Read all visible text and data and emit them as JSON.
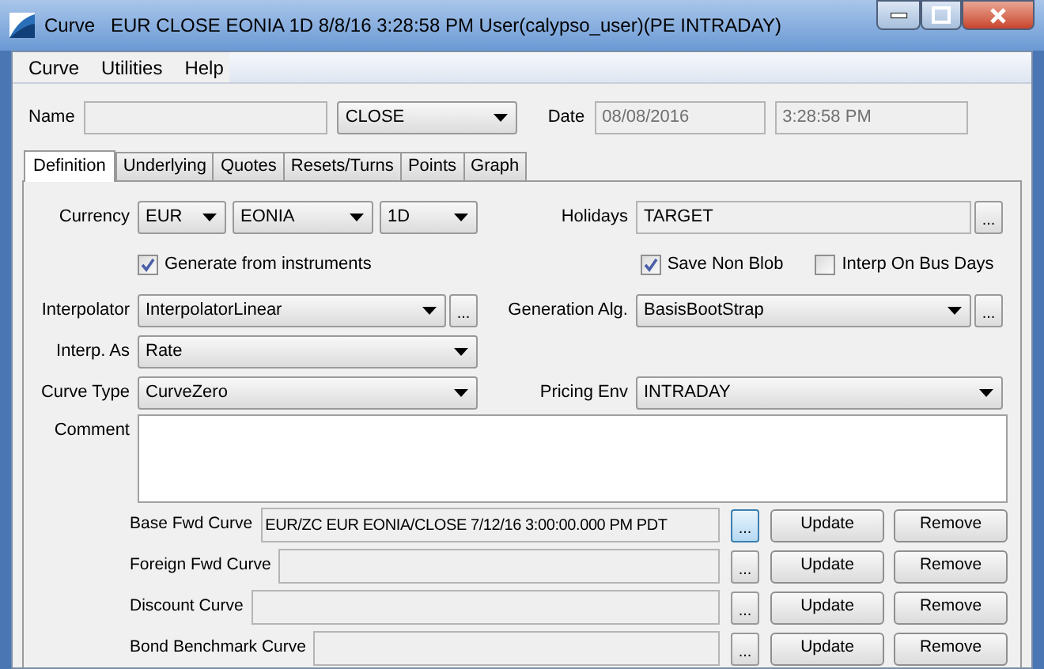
{
  "window": {
    "title": "Curve   EUR CLOSE EONIA 1D 8/8/16 3:28:58 PM User(calypso_user)(PE INTRADAY)"
  },
  "menu": [
    "Curve",
    "Utilities",
    "Help"
  ],
  "header": {
    "name_label": "Name",
    "name_type": "CLOSE",
    "date_label": "Date",
    "date": "08/08/2016",
    "time": "3:28:58 PM"
  },
  "tabs": [
    {
      "label": "Definition",
      "selected": true
    },
    {
      "label": "Underlying",
      "selected": false
    },
    {
      "label": "Quotes",
      "selected": false
    },
    {
      "label": "Resets/Turns",
      "selected": false
    },
    {
      "label": "Points",
      "selected": false
    },
    {
      "label": "Graph",
      "selected": false
    }
  ],
  "definition": {
    "currency": {
      "label": "Currency",
      "combos": [
        "EUR",
        "EONIA",
        "1D"
      ]
    },
    "holidays": {
      "label": "Holidays",
      "value": "TARGET",
      "browse": "..."
    },
    "generate_from_instruments": {
      "label": "Generate from instruments",
      "checked": true
    },
    "save_non_blob": {
      "label": "Save Non Blob",
      "checked": true
    },
    "interp_on_bus_days": {
      "label": "Interp On Bus Days",
      "checked": false
    },
    "interpolator": {
      "label": "Interpolator",
      "value": "InterpolatorLinear",
      "browse": "..."
    },
    "generation_alg": {
      "label": "Generation Alg.",
      "value": "BasisBootStrap",
      "browse": "..."
    },
    "interp_as": {
      "label": "Interp. As",
      "value": "Rate"
    },
    "curve_type": {
      "label": "Curve Type",
      "value": "CurveZero"
    },
    "pricing_env": {
      "label": "Pricing Env",
      "value": "INTRADAY"
    },
    "comment": {
      "label": "Comment"
    },
    "curves": [
      {
        "label": "Base Fwd Curve",
        "value": "EUR/ZC EUR EONIA/CLOSE 7/12/16 3:00:00.000 PM PDT",
        "browse": "...",
        "focused": true,
        "update": "Update",
        "remove": "Remove"
      },
      {
        "label": "Foreign Fwd Curve",
        "browse": "...",
        "focused": false,
        "update": "Update",
        "remove": "Remove"
      },
      {
        "label": "Discount Curve",
        "browse": "...",
        "focused": false,
        "update": "Update",
        "remove": "Remove"
      },
      {
        "label": "Bond Benchmark Curve",
        "browse": "...",
        "focused": false,
        "update": "Update",
        "remove": "Remove"
      }
    ]
  }
}
